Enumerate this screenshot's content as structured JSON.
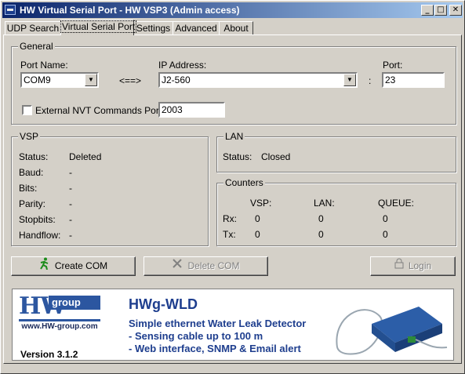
{
  "window": {
    "title": "HW Virtual Serial Port - HW VSP3 (Admin access)",
    "minimize": "_",
    "maximize": "□",
    "close": "✕"
  },
  "tabs": [
    "UDP Search",
    "Virtual Serial Port",
    "Settings",
    "Advanced",
    "About"
  ],
  "active_tab": "Virtual Serial Port",
  "general": {
    "caption": "General",
    "port_name_label": "Port Name:",
    "port_name_value": "COM9",
    "arrow": "<==>",
    "ip_label": "IP Address:",
    "ip_value": "J2-560",
    "colon": ":",
    "port_label": "Port:",
    "port_value": "23",
    "nvt_label": "External NVT Commands Port:",
    "nvt_value": "2003",
    "nvt_checked": false
  },
  "vsp": {
    "caption": "VSP",
    "rows": [
      {
        "label": "Status:",
        "value": "Deleted"
      },
      {
        "label": "Baud:",
        "value": "-"
      },
      {
        "label": "Bits:",
        "value": "-"
      },
      {
        "label": "Parity:",
        "value": "-"
      },
      {
        "label": "Stopbits:",
        "value": "-"
      },
      {
        "label": "Handflow:",
        "value": "-"
      }
    ]
  },
  "lan": {
    "caption": "LAN",
    "status_label": "Status:",
    "status_value": "Closed"
  },
  "counters": {
    "caption": "Counters",
    "headers": [
      "VSP:",
      "LAN:",
      "QUEUE:"
    ],
    "rx_label": "Rx:",
    "tx_label": "Tx:",
    "rx": [
      "0",
      "0",
      "0"
    ],
    "tx": [
      "0",
      "0",
      "0"
    ]
  },
  "buttons": {
    "create": "Create COM",
    "delete": "Delete COM",
    "login": "Login"
  },
  "banner": {
    "logo_hw": "HW",
    "logo_group": "group",
    "logo_url": "www.HW-group.com",
    "version": "Version  3.1.2",
    "product": "HWg-WLD",
    "line1": "Simple ethernet Water Leak Detector",
    "line2": " - Sensing cable up to 100 m",
    "line3": " - Web interface, SNMP & Email alert"
  },
  "colors": {
    "title_start": "#0a246a",
    "title_end": "#a6caf0",
    "face": "#d4d0c8",
    "brand_blue": "#2c56a0"
  }
}
